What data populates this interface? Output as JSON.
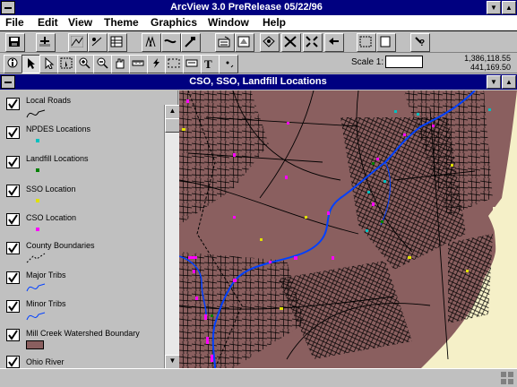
{
  "app": {
    "title": "ArcView 3.0 PreRelease 05/22/96"
  },
  "menu": [
    {
      "label": "File"
    },
    {
      "label": "Edit"
    },
    {
      "label": "View"
    },
    {
      "label": "Theme"
    },
    {
      "label": "Graphics"
    },
    {
      "label": "Window"
    },
    {
      "label": "Help"
    }
  ],
  "scale": {
    "label": "Scale 1:",
    "value": "",
    "coord_x": "1,386,118.55",
    "coord_y": "441,169.50"
  },
  "view": {
    "title": "CSO, SSO, Landfill Locations"
  },
  "legend": [
    {
      "label": "Local Roads",
      "symbol": "line",
      "color": "#000000"
    },
    {
      "label": "NPDES Locations",
      "symbol": "point",
      "color": "#00c0c0"
    },
    {
      "label": "Landfill Locations",
      "symbol": "point",
      "color": "#008000"
    },
    {
      "label": "SSO Location",
      "symbol": "point",
      "color": "#e0e000"
    },
    {
      "label": "CSO Location",
      "symbol": "point",
      "color": "#ff00ff"
    },
    {
      "label": "County Boundaries",
      "symbol": "dashed-line",
      "color": "#000000"
    },
    {
      "label": "Major Tribs",
      "symbol": "line",
      "color": "#0040ff"
    },
    {
      "label": "Minor Tribs",
      "symbol": "line",
      "color": "#0040ff"
    },
    {
      "label": "Mill Creek Watershed Boundary",
      "symbol": "polygon",
      "color": "#8a5f5f"
    },
    {
      "label": "Ohio River",
      "symbol": "polygon",
      "color": "#c0c0c0"
    }
  ],
  "colors": {
    "titlebar": "#000080",
    "watershed": "#8a5f5f",
    "outside": "#f5f0c8",
    "road": "#000000",
    "river": "#0040ff",
    "cso": "#ff00ff",
    "sso": "#e0e000",
    "npdes": "#00c0c0",
    "landfill": "#008000"
  }
}
